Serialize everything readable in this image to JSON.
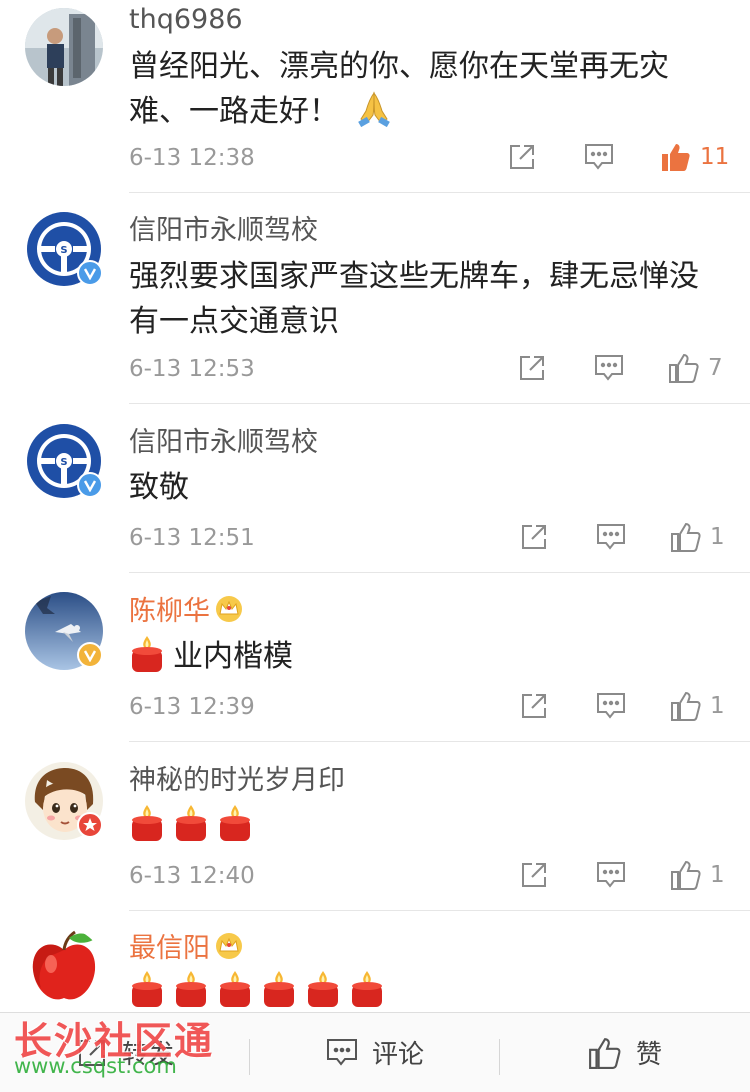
{
  "comments": [
    {
      "username": "thq6986",
      "text": "曾经阳光、漂亮的你、愿你在天堂再无灾难、一路走好！",
      "emoji": "praying-hands",
      "time": "6-13 12:38",
      "likes": "11",
      "liked": true
    },
    {
      "username": "信阳市永顺驾校",
      "text": "强烈要求国家严查这些无牌车，肆无忌惮没有一点交通意识",
      "time": "6-13 12:53",
      "likes": "7",
      "badge": "blue-verified"
    },
    {
      "username": "信阳市永顺驾校",
      "text": "致敬",
      "time": "6-13 12:51",
      "likes": "1",
      "badge": "blue-verified"
    },
    {
      "username": "陈柳华",
      "text": "业内楷模",
      "emoji": "candle",
      "time": "6-13 12:39",
      "likes": "1",
      "badge": "gold-verified",
      "vip": true
    },
    {
      "username": "神秘的时光岁月印",
      "emoji_count": 3,
      "time": "6-13 12:40",
      "likes": "1",
      "badge": "red-star"
    },
    {
      "username": "最信阳",
      "emoji_count": 6,
      "vip": true
    }
  ],
  "bottom_bar": {
    "repost_label": "转发",
    "comment_label": "评论",
    "like_label": "赞"
  },
  "watermark": {
    "title": "长沙社区通",
    "url": "www.csqst.com"
  },
  "colors": {
    "accent_orange": "#eb7340",
    "meta_gray": "#999999",
    "verified_blue": "#4a9be8"
  }
}
